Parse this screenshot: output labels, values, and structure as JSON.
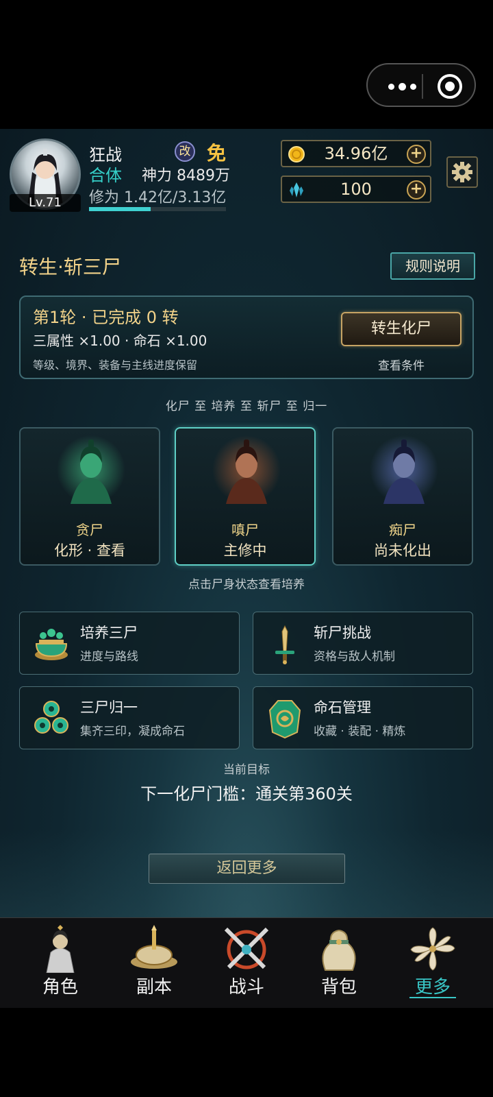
{
  "profile": {
    "name": "狂战",
    "chip": "改",
    "rank": "免",
    "realm": "合体",
    "power": "神力 8489万",
    "exp": "修为 1.42亿/3.13亿",
    "exp_progress": 0.45,
    "level": "Lv.71"
  },
  "currencies": {
    "gold": {
      "value": "34.96亿",
      "icon": "gold-coin-icon"
    },
    "jade": {
      "value": "100",
      "icon": "crystal-icon"
    }
  },
  "section": {
    "title": "转生·斩三尸",
    "rules_label": "规则说明"
  },
  "round": {
    "line1": "第1轮 · 已完成 0 转",
    "line2": "三属性 ×1.00 · 命石 ×1.00",
    "line3": "等级、境界、装备与主线进度保留",
    "button": "转生化尸",
    "link": "查看条件"
  },
  "path_text": "化尸 至 培养 至 斩尸 至 归一",
  "corpses": [
    {
      "name": "贪尸",
      "state": "化形 · 查看",
      "color": "#2fb87a"
    },
    {
      "name": "嗔尸",
      "state": "主修中",
      "color": "#c2562c"
    },
    {
      "name": "痴尸",
      "state": "尚未化出",
      "color": "#6a7bd6"
    }
  ],
  "hint": "点击尸身状态查看培养",
  "features": [
    {
      "title": "培养三尸",
      "subtitle": "进度与路线",
      "icon": "cauldron-icon"
    },
    {
      "title": "斩尸挑战",
      "subtitle": "资格与敌人机制",
      "icon": "sword-icon"
    },
    {
      "title": "三尸归一",
      "subtitle": "集齐三印，凝成命石",
      "icon": "triskelion-icon"
    },
    {
      "title": "命石管理",
      "subtitle": "收藏 · 装配 · 精炼",
      "icon": "jade-stone-icon"
    }
  ],
  "goal": {
    "label": "当前目标",
    "text": "下一化尸门槛：通关第360关"
  },
  "back_label": "返回更多",
  "tabs": [
    {
      "label": "角色",
      "icon": "character-icon"
    },
    {
      "label": "副本",
      "icon": "dungeon-altar-icon"
    },
    {
      "label": "战斗",
      "icon": "crossed-swords-icon"
    },
    {
      "label": "背包",
      "icon": "bag-icon"
    },
    {
      "label": "更多",
      "icon": "more-flower-icon",
      "active": true
    }
  ],
  "colors": {
    "accent": "#39c6c6",
    "gold_text": "#f3d38a"
  }
}
